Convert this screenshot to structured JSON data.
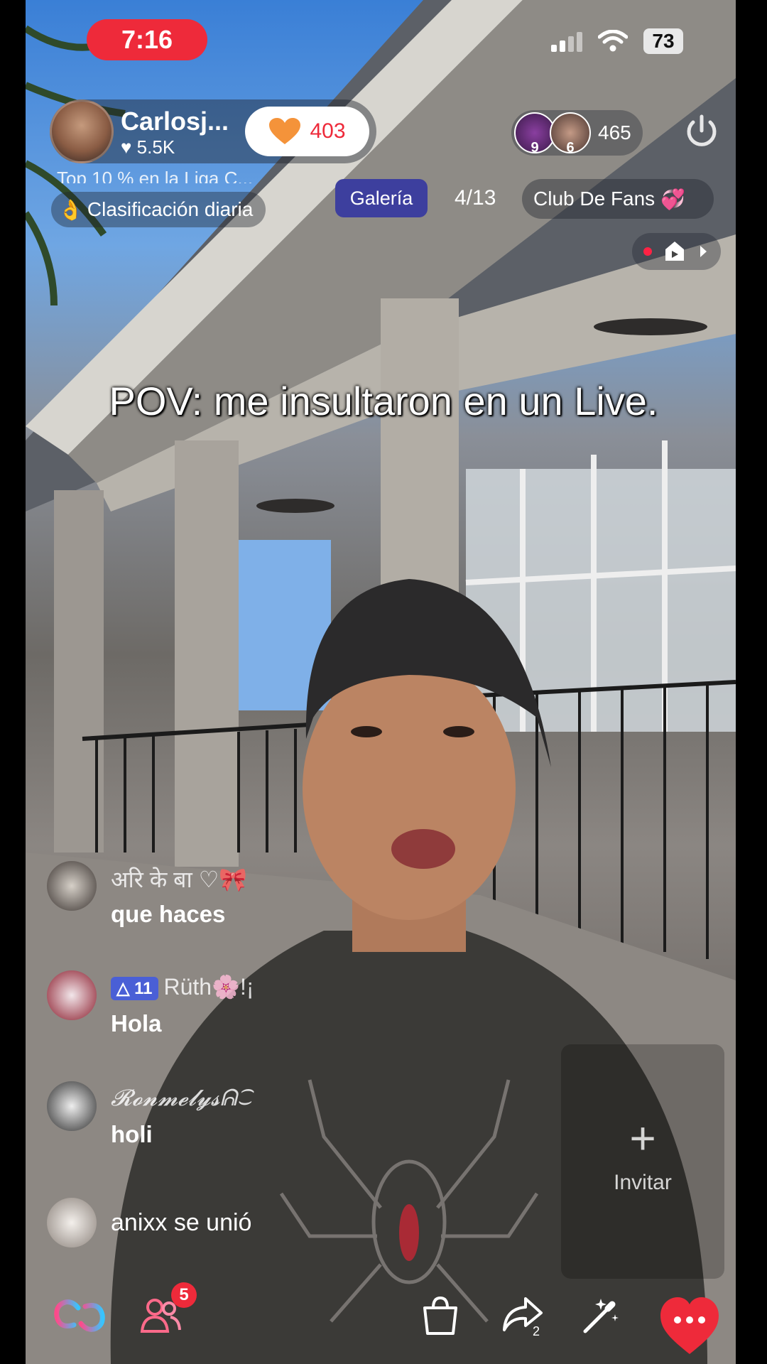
{
  "status_bar": {
    "time": "7:16",
    "battery": "73"
  },
  "host": {
    "name": "Carlosj...",
    "likes": "5.5K",
    "follow_count": "403"
  },
  "rankings": {
    "top_line": "Top 10 % en la Liga C...",
    "daily": "Clasificación diaria"
  },
  "viewers": {
    "avatar1_num": "9",
    "avatar2_num": "6",
    "count": "465"
  },
  "tabs": {
    "galeria": "Galería",
    "gallery_counter": "4/13",
    "fans": "Club De Fans"
  },
  "caption": "POV: me insultaron en un Live.",
  "comments": [
    {
      "user": "अरि के बा ♡🎀",
      "text": "que haces"
    },
    {
      "badge": "11",
      "user": "Rüth🌸!¡",
      "text": "Hola"
    },
    {
      "user": "𝓡𝓸𝓷𝓶𝓮𝓵𝔂𝓼ᕱ⁐",
      "text": "holi"
    }
  ],
  "join_event": "anixx se unió",
  "invite": {
    "label": "Invitar"
  },
  "bottom_bar": {
    "friends_badge": "5",
    "share_count": "2"
  },
  "colors": {
    "accent_red": "#ee2a3a",
    "gallery_blue": "#3d3f9e",
    "follow_orange": "#f4933a"
  },
  "icons": [
    "signal-icon",
    "wifi-icon",
    "heart-icon",
    "power-icon",
    "record-icon",
    "play-icon",
    "chevron-right-icon",
    "link-icon",
    "people-icon",
    "bag-icon",
    "share-icon",
    "magic-wand-icon",
    "more-icon"
  ]
}
